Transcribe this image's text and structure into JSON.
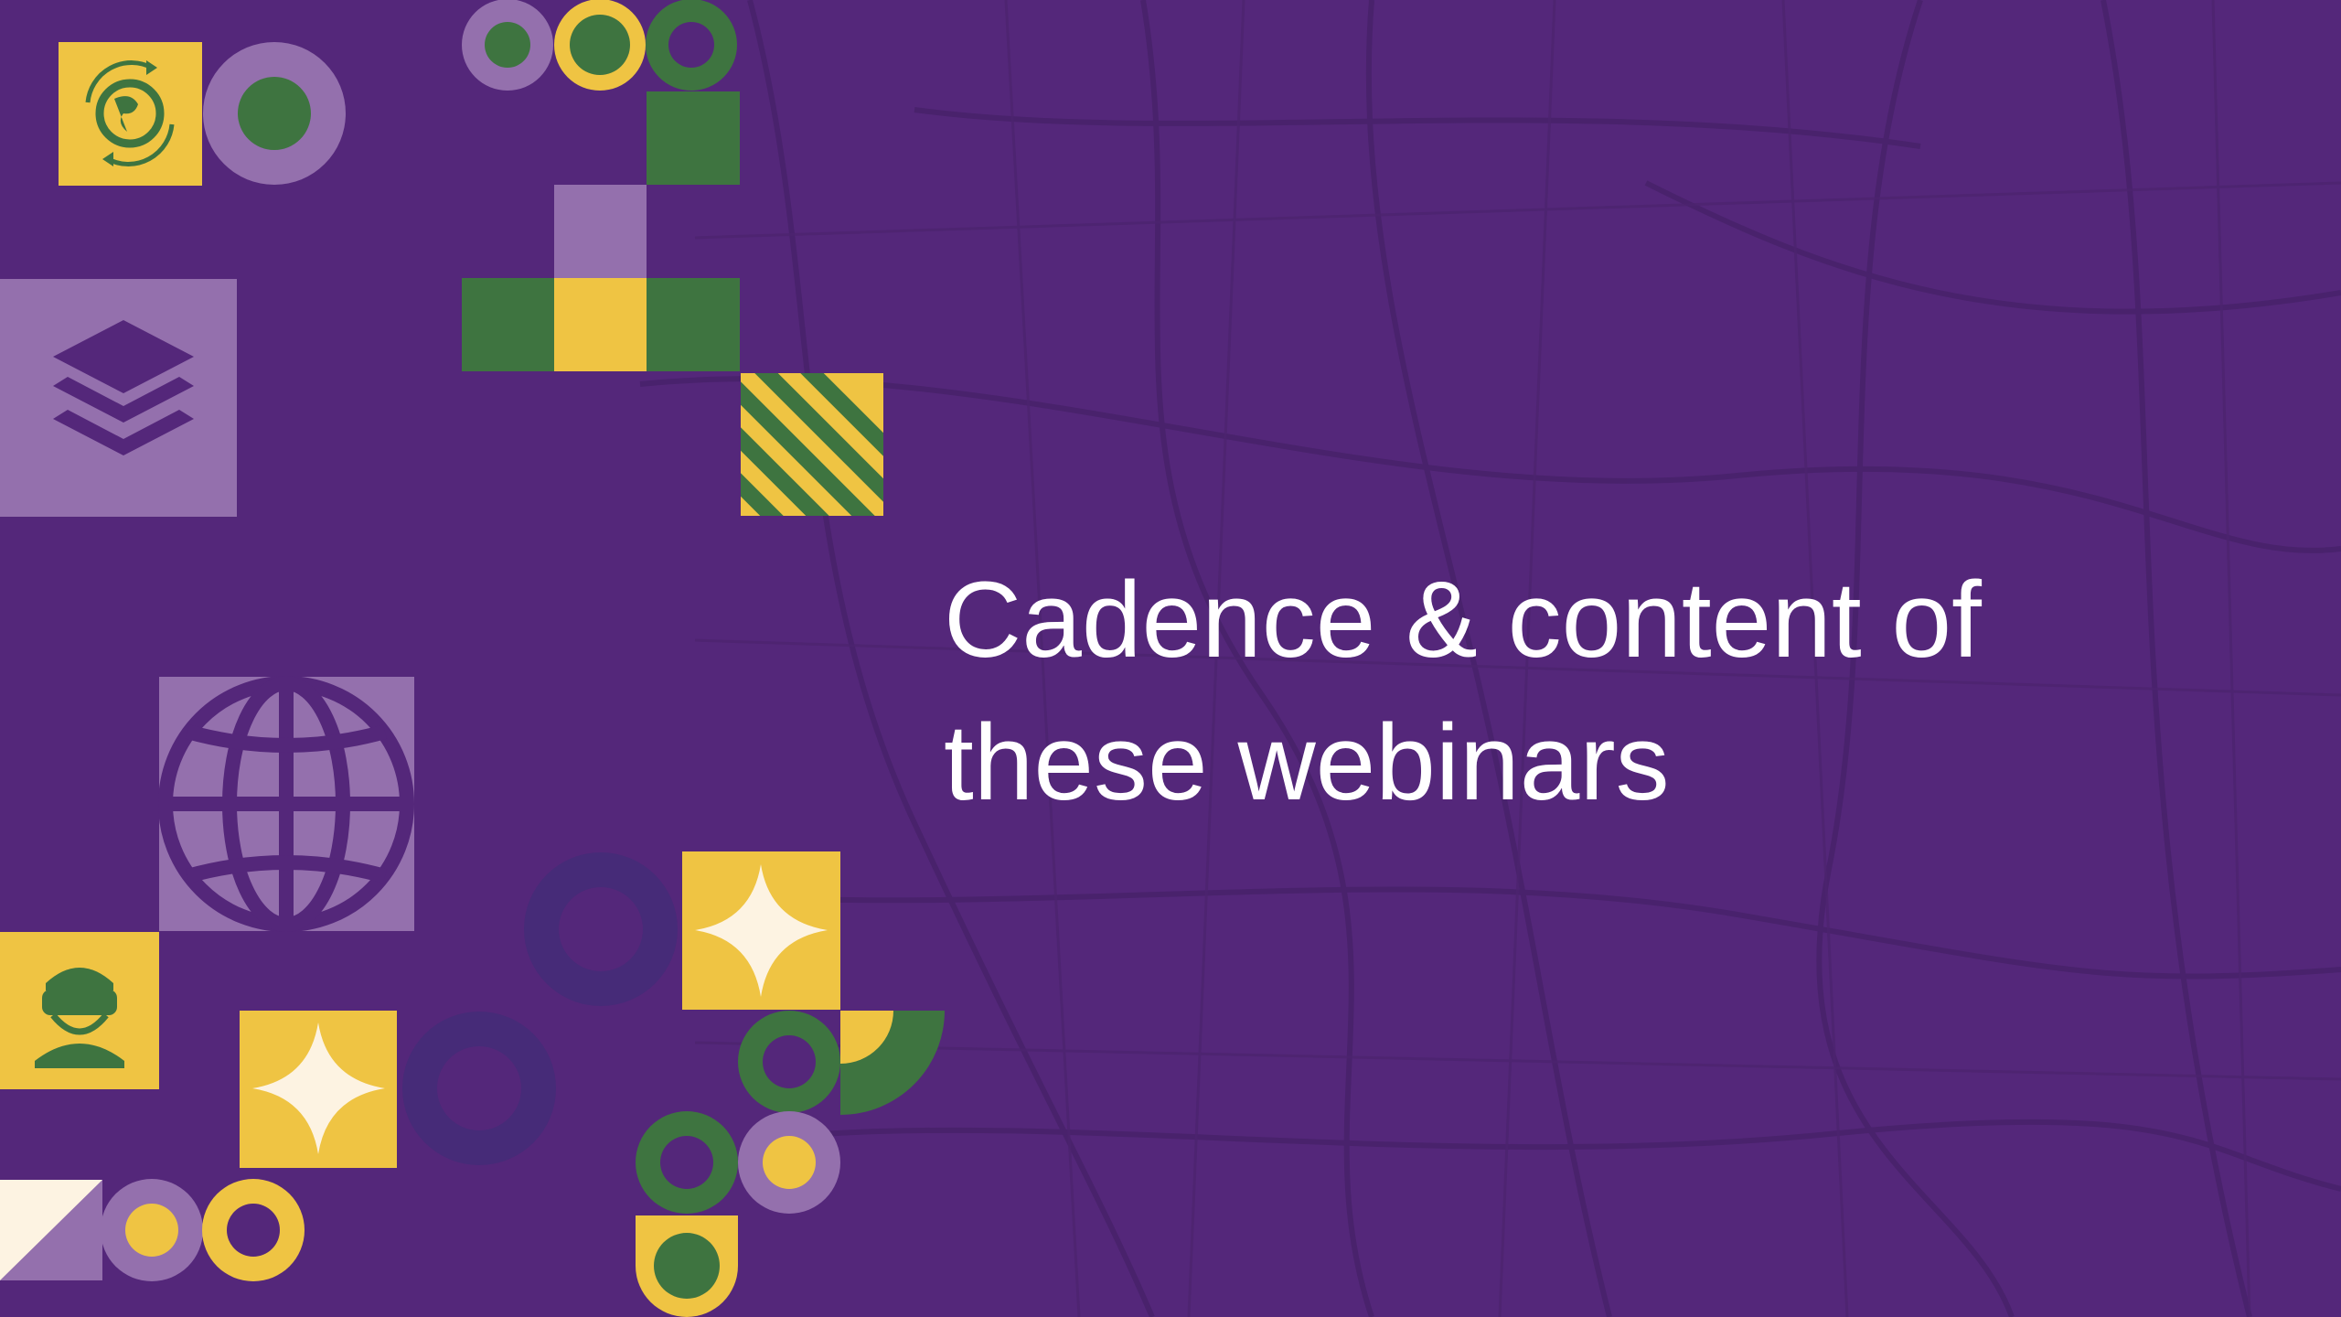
{
  "slide": {
    "title_line_1": "Cadence & content of",
    "title_line_2": "these webinars"
  },
  "colors": {
    "background": "#54277a",
    "map_lines": "#48226b",
    "yellow": "#efc443",
    "green": "#3e7440",
    "lavender": "#9470ad",
    "deep_purple": "#462b78",
    "cream": "#fdf3e2"
  },
  "icons": [
    "globe-cycle-icon",
    "layers-icon",
    "world-globe-icon",
    "vr-headset-person-icon",
    "sparkle-icon"
  ]
}
